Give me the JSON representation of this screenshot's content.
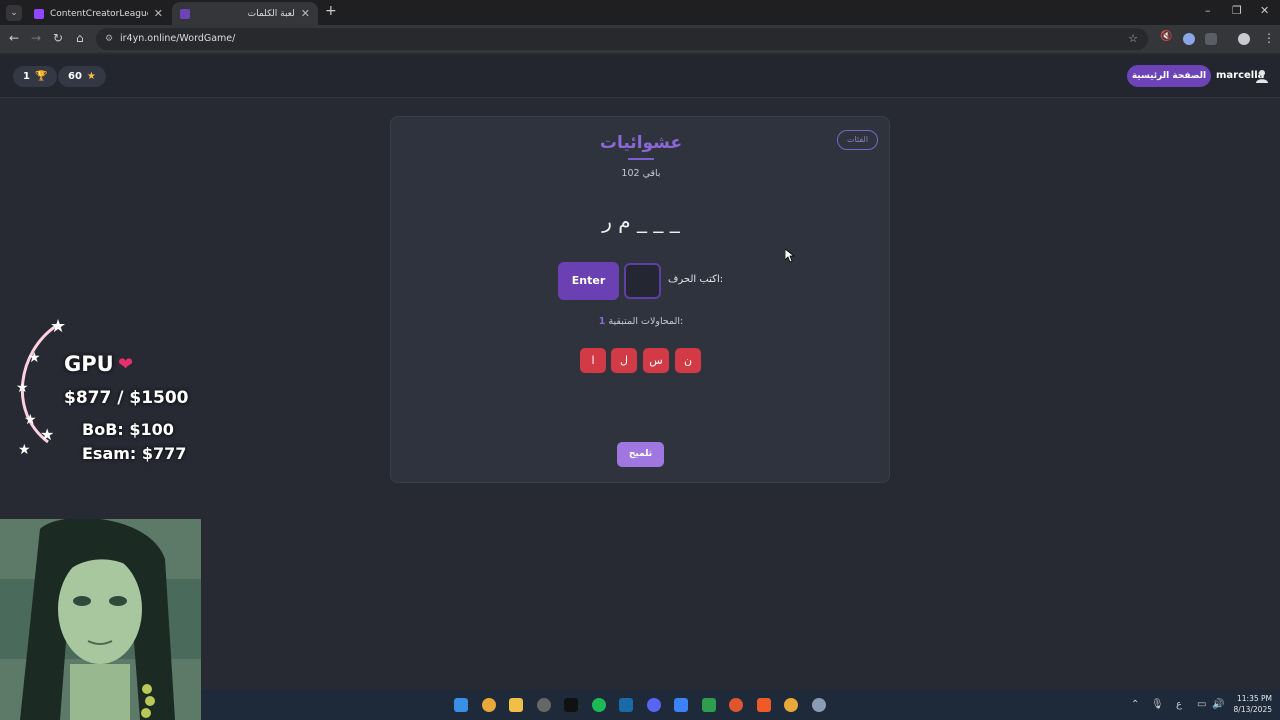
{
  "browser": {
    "tabs": [
      {
        "title": "ContentCreatorLeague - Twitch",
        "favicon_color": "#9146ff"
      },
      {
        "title": "لعبة الكلمات",
        "favicon_color": "#6c44b8"
      }
    ],
    "url": "ir4yn.online/WordGame/",
    "new_tab_icon": "+",
    "window_controls": {
      "minimize": "–",
      "maximize": "❐",
      "close": "✕"
    }
  },
  "header": {
    "trophy_count": "1",
    "stars_count": "60",
    "home_button": "الصفحة الرئيسية",
    "username": "marcella"
  },
  "game": {
    "categories_button": "الفئات",
    "title": "عشوائيات",
    "remaining": "باقي 102",
    "word_display": "م ر _ _ _",
    "enter_button": "Enter",
    "input_label": "اكتب الحرف:",
    "attempts_label": "المحاولات المتبقية:",
    "attempts_value": "1",
    "used_letters": [
      "ا",
      "ل",
      "س",
      "ن"
    ],
    "hint_button": "تلميح"
  },
  "overlay": {
    "gpu_title": "GPU",
    "gpu_progress": "$877 / $1500",
    "donors": [
      "BoB: $100",
      "Esam: $777"
    ]
  },
  "taskbar": {
    "time": "11:35 PM",
    "date": "8/13/2025",
    "lang": "ع"
  },
  "colors": {
    "accent": "#6c44b8",
    "used_letter": "#d23a45",
    "background": "#272a33",
    "card": "#2f333e"
  }
}
